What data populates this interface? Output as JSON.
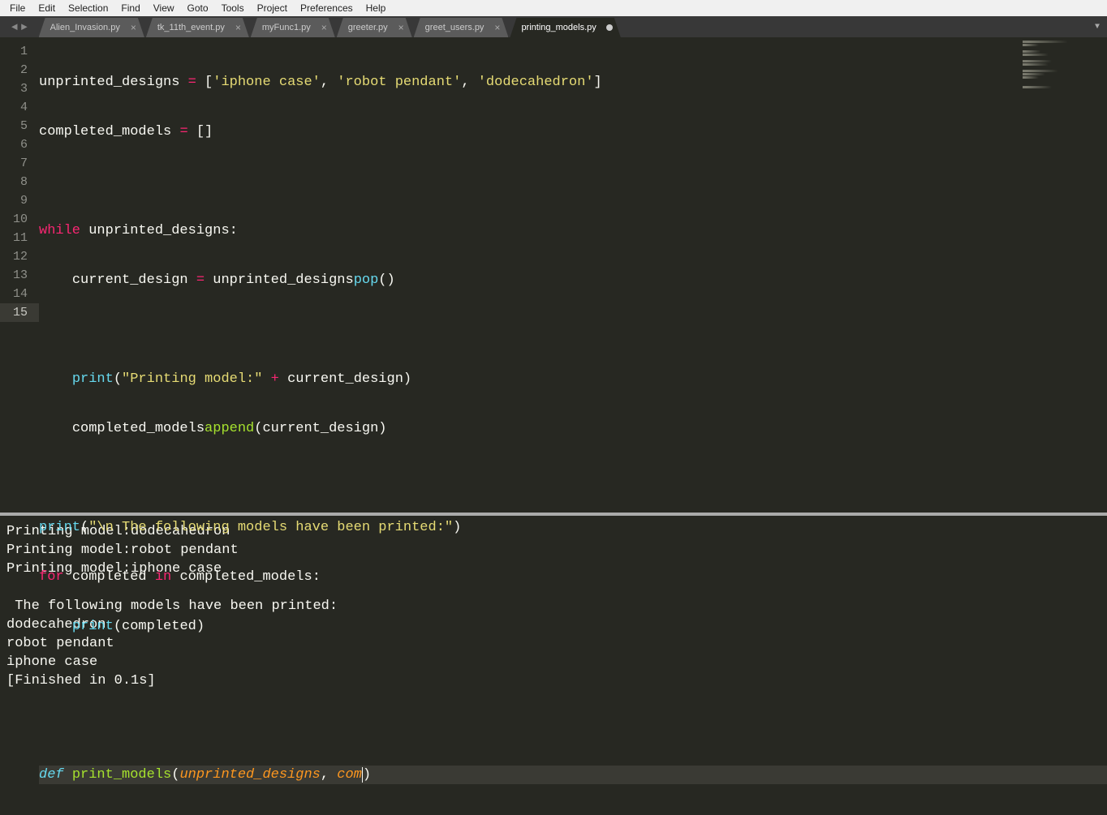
{
  "menu": [
    "File",
    "Edit",
    "Selection",
    "Find",
    "View",
    "Goto",
    "Tools",
    "Project",
    "Preferences",
    "Help"
  ],
  "nav": {
    "back": "◄",
    "fwd": "►"
  },
  "tabs": [
    {
      "label": "Alien_Invasion.py",
      "active": false,
      "dirty": false
    },
    {
      "label": "tk_11th_event.py",
      "active": false,
      "dirty": false
    },
    {
      "label": "myFunc1.py",
      "active": false,
      "dirty": false
    },
    {
      "label": "greeter.py",
      "active": false,
      "dirty": false
    },
    {
      "label": "greet_users.py",
      "active": false,
      "dirty": false
    },
    {
      "label": "printing_models.py",
      "active": true,
      "dirty": true
    }
  ],
  "tabmenu_icon": "▼",
  "line_count": 15,
  "highlight_line": 15,
  "code": {
    "l1": {
      "a": "unprinted_designs ",
      "eq": "=",
      "sp": " [",
      "s1": "'iphone case'",
      "c1": ", ",
      "s2": "'robot pendant'",
      "c2": ", ",
      "s3": "'dodecahedron'",
      "end": "]"
    },
    "l2": {
      "a": "completed_models ",
      "eq": "=",
      "end": " []"
    },
    "l4": {
      "kw": "while",
      "sp": " ",
      "id": "unprinted_designs",
      ":": ":"
    },
    "l5": {
      "ind": "    ",
      "a": "current_design ",
      "eq": "=",
      "sp": " ",
      "b": "unprinted_designs",
      ".": ".",
      "fn": "pop",
      "p": "()"
    },
    "l7": {
      "ind": "    ",
      "fn": "print",
      "p1": "(",
      "s": "\"Printing model:\"",
      "sp": " ",
      "op": "+",
      "sp2": " ",
      "id": "current_design",
      "p2": ")"
    },
    "l8": {
      "ind": "    ",
      "a": "completed_models",
      ".": ".",
      "fn": "append",
      "p": "(current_design)"
    },
    "l10": {
      "fn": "print",
      "p1": "(",
      "s": "\"\\n The following models have been printed:\"",
      "p2": ")"
    },
    "l11": {
      "kw": "for",
      "sp": " ",
      "id": "completed",
      "sp2": " ",
      "kw2": "in",
      "sp3": " ",
      "id2": "completed_models",
      ":": ":"
    },
    "l12": {
      "ind": "    ",
      "fn": "print",
      "p": "(completed)"
    },
    "l15": {
      "def": "def",
      "sp": " ",
      "name": "print_models",
      "p1": "(",
      "param1": "unprinted_designs",
      "c": ", ",
      "param2": "com",
      "p2": ")"
    }
  },
  "output_lines": [
    "Printing model:dodecahedron",
    "Printing model:robot pendant",
    "Printing model:iphone case",
    "",
    " The following models have been printed:",
    "dodecahedron",
    "robot pendant",
    "iphone case",
    "[Finished in 0.1s]"
  ]
}
